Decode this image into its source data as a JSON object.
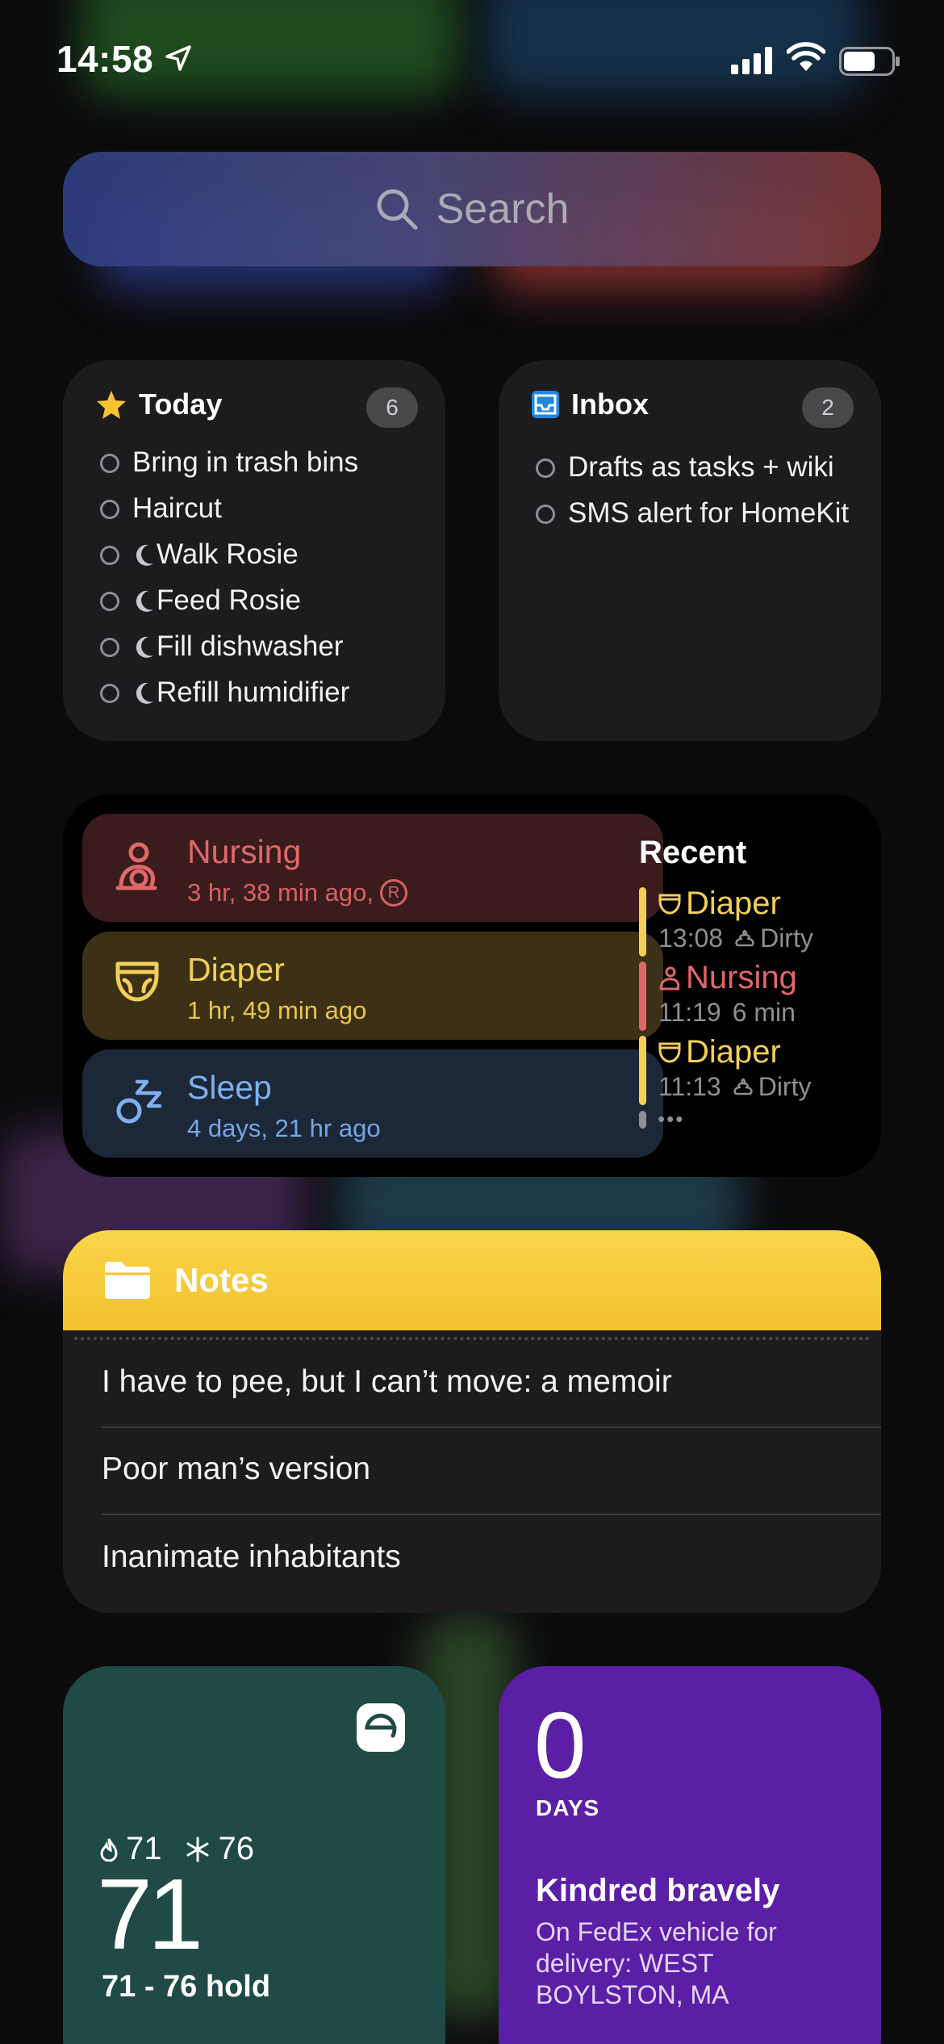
{
  "status": {
    "time": "14:58"
  },
  "search": {
    "placeholder": "Search"
  },
  "today": {
    "title": "Today",
    "count": "6",
    "tasks": [
      {
        "label": "Bring in trash bins",
        "evening": false
      },
      {
        "label": "Haircut",
        "evening": false
      },
      {
        "label": "Walk Rosie",
        "evening": true
      },
      {
        "label": "Feed Rosie",
        "evening": true
      },
      {
        "label": "Fill dishwasher",
        "evening": true
      },
      {
        "label": "Refill humidifier",
        "evening": true
      }
    ]
  },
  "inbox": {
    "title": "Inbox",
    "count": "2",
    "tasks": [
      {
        "label": "Drafts as tasks + wiki"
      },
      {
        "label": "SMS alert for HomeKit"
      }
    ]
  },
  "baby": {
    "nursing": {
      "label": "Nursing",
      "ago": "3 hr, 38 min ago,",
      "side": "R"
    },
    "diaper": {
      "label": "Diaper",
      "ago": "1 hr, 49 min ago"
    },
    "sleep": {
      "label": "Sleep",
      "ago": "4 days, 21 hr ago"
    },
    "recent_title": "Recent",
    "recent": [
      {
        "type": "Diaper",
        "time": "13:08",
        "detail": "Dirty"
      },
      {
        "type": "Nursing",
        "time": "11:19",
        "detail": "6 min"
      },
      {
        "type": "Diaper",
        "time": "11:13",
        "detail": "Dirty"
      }
    ],
    "more": "•••"
  },
  "notes": {
    "title": "Notes",
    "items": [
      "I have to pee, but I can’t move: a memoir",
      "Poor man’s version",
      "Inanimate inhabitants"
    ]
  },
  "thermostat": {
    "heat": "71",
    "cool": "76",
    "current": "71",
    "mode": "71 - 76 hold"
  },
  "countdown": {
    "value": "0",
    "unit": "DAYS",
    "title": "Kindred bravely",
    "subtitle": "On FedEx vehicle for delivery: WEST BOYLSTON, MA"
  },
  "colors": {
    "nursing": "#e0676a",
    "diaper": "#f2cf56",
    "sleep": "#7fb0ee",
    "notes": "#f5c93a",
    "accent_blue": "#1e88e5"
  }
}
